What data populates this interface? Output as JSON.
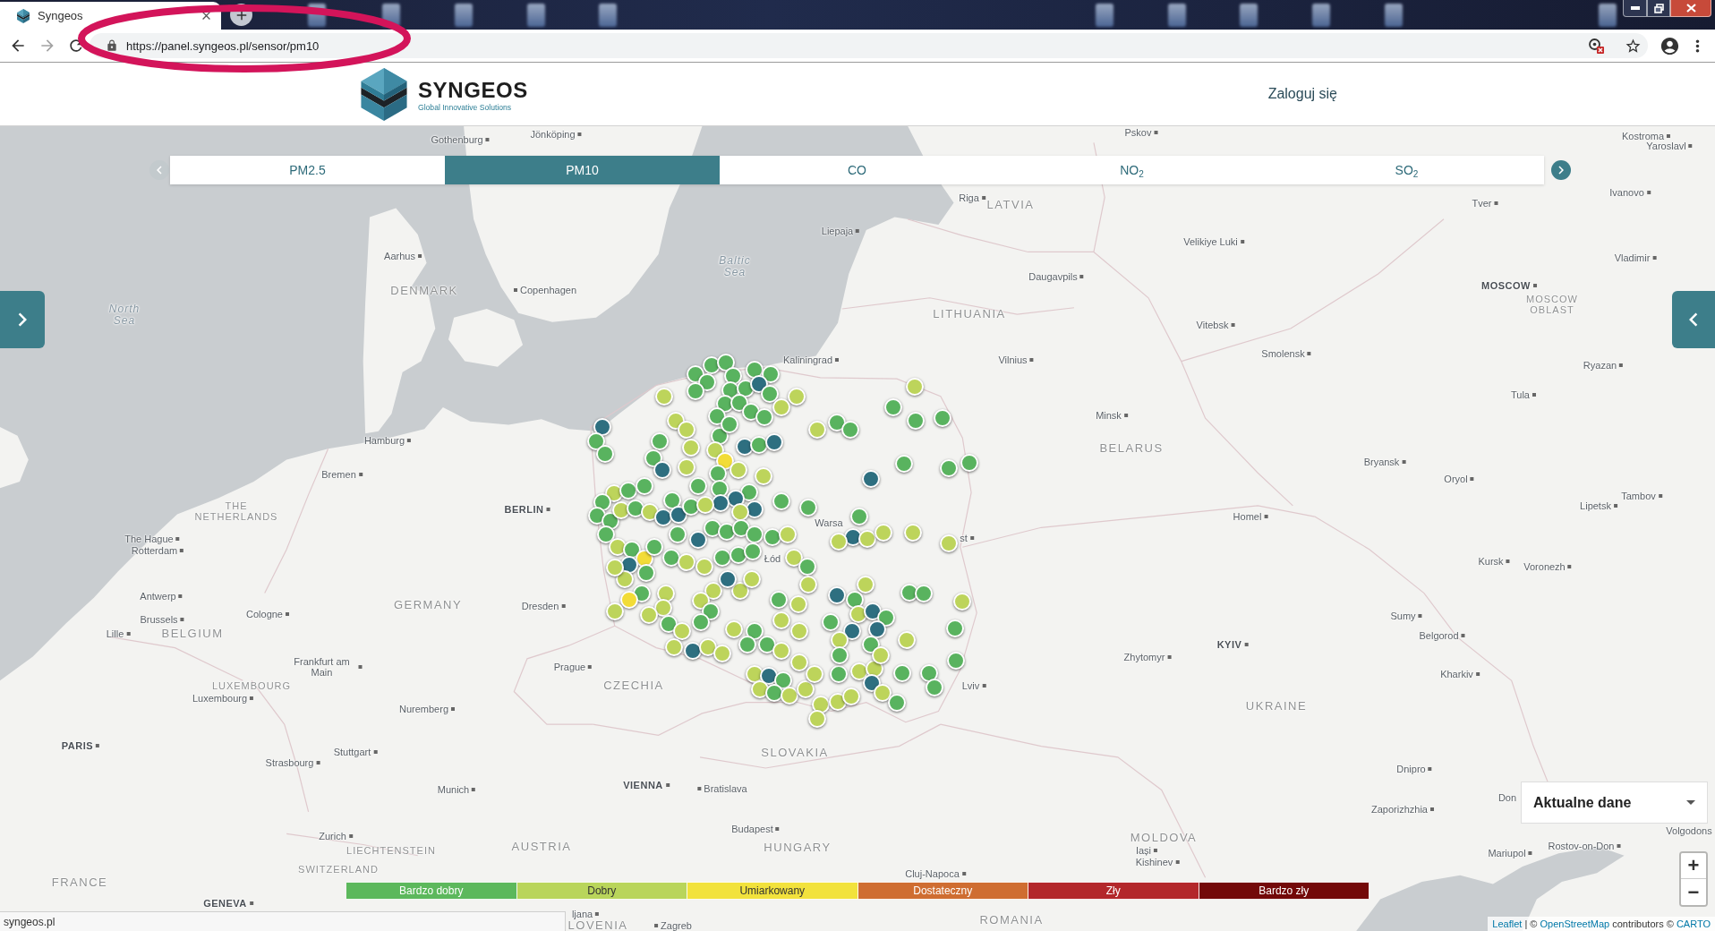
{
  "browser": {
    "tab": {
      "title": "Syngeos"
    },
    "back_button": {
      "disabled": false
    },
    "forward_button": {
      "disabled": true
    },
    "url": "https://panel.syngeos.pl/sensor/pm10",
    "status_text": "syngeos.pl"
  },
  "header": {
    "brand": "SYNGEOS",
    "tagline": "Global Innovative Solutions",
    "login": "Zaloguj się"
  },
  "pollutant_tabs": {
    "prev_button": {
      "disabled": true
    },
    "next_button": {
      "disabled": false
    },
    "tabs": [
      {
        "label": "PM2.5",
        "selected": false
      },
      {
        "label": "PM10",
        "selected": true
      },
      {
        "label": "CO",
        "selected": false
      },
      {
        "label": "NO$_{2}$",
        "selected": false
      },
      {
        "label": "SO$_{2}$",
        "selected": false
      }
    ]
  },
  "map": {
    "labels": [
      {
        "text": "Gothenburg",
        "kind": "city"
      },
      {
        "text": "Jönköping",
        "kind": "city"
      },
      {
        "text": "Pskov",
        "kind": "city"
      },
      {
        "text": "Kostroma",
        "kind": "city"
      },
      {
        "text": "Yaroslavl",
        "kind": "city"
      },
      {
        "text": "Riga",
        "kind": "city"
      },
      {
        "text": "LATVIA",
        "kind": "country"
      },
      {
        "text": "Tver",
        "kind": "city"
      },
      {
        "text": "Ivanovo",
        "kind": "city"
      },
      {
        "text": "Liepaja",
        "kind": "city"
      },
      {
        "text": "Velikiye Luki",
        "kind": "city"
      },
      {
        "text": "Aarhus",
        "kind": "city"
      },
      {
        "text": "Baltic Sea",
        "kind": "sea"
      },
      {
        "text": "Vladimir",
        "kind": "city"
      },
      {
        "text": "Daugavpils",
        "kind": "city"
      },
      {
        "text": "DENMARK",
        "kind": "country"
      },
      {
        "text": "Copenhagen",
        "kind": "city"
      },
      {
        "text": "MOSCOW",
        "kind": "capital"
      },
      {
        "text": "North Sea",
        "kind": "sea"
      },
      {
        "text": "LITHUANIA",
        "kind": "country"
      },
      {
        "text": "MOSCOW OBLAST",
        "kind": "region"
      },
      {
        "text": "Vitebsk",
        "kind": "city"
      },
      {
        "text": "Kaliningrad",
        "kind": "city"
      },
      {
        "text": "Vilnius",
        "kind": "city"
      },
      {
        "text": "Smolensk",
        "kind": "city"
      },
      {
        "text": "Ryazan",
        "kind": "city"
      },
      {
        "text": "Tula",
        "kind": "city"
      },
      {
        "text": "Minsk",
        "kind": "city"
      },
      {
        "text": "Hamburg",
        "kind": "city"
      },
      {
        "text": "BELARUS",
        "kind": "country"
      },
      {
        "text": "Bryansk",
        "kind": "city"
      },
      {
        "text": "Bremen",
        "kind": "city"
      },
      {
        "text": "Oryol",
        "kind": "city"
      },
      {
        "text": "THE NETHERLANDS",
        "kind": "region"
      },
      {
        "text": "BERLIN",
        "kind": "capital"
      },
      {
        "text": "Warsa",
        "kind": "city"
      },
      {
        "text": "Homel",
        "kind": "city"
      },
      {
        "text": "Lipetsk",
        "kind": "city"
      },
      {
        "text": "Tambov",
        "kind": "city"
      },
      {
        "text": "The Hague",
        "kind": "city"
      },
      {
        "text": "st",
        "kind": "city"
      },
      {
        "text": "Rotterdam",
        "kind": "city"
      },
      {
        "text": "Łód",
        "kind": "city"
      },
      {
        "text": "Kursk",
        "kind": "city"
      },
      {
        "text": "Voronezh",
        "kind": "city"
      },
      {
        "text": "Antwerp",
        "kind": "city"
      },
      {
        "text": "Brussels",
        "kind": "city"
      },
      {
        "text": "Cologne",
        "kind": "city"
      },
      {
        "text": "GERMANY",
        "kind": "country"
      },
      {
        "text": "Dresden",
        "kind": "city"
      },
      {
        "text": "Sumy",
        "kind": "city"
      },
      {
        "text": "Lille",
        "kind": "city"
      },
      {
        "text": "BELGIUM",
        "kind": "country"
      },
      {
        "text": "KYIV",
        "kind": "capital"
      },
      {
        "text": "Belgorod",
        "kind": "city"
      },
      {
        "text": "Frankfurt am Main",
        "kind": "city"
      },
      {
        "text": "Prague",
        "kind": "city"
      },
      {
        "text": "Zhytomyr",
        "kind": "city"
      },
      {
        "text": "Kharkiv",
        "kind": "city"
      },
      {
        "text": "LUXEMBOURG",
        "kind": "region"
      },
      {
        "text": "CZECHIA",
        "kind": "country"
      },
      {
        "text": "Lviv",
        "kind": "city"
      },
      {
        "text": "Luxembourg",
        "kind": "city"
      },
      {
        "text": "Nuremberg",
        "kind": "city"
      },
      {
        "text": "UKRAINE",
        "kind": "country"
      },
      {
        "text": "PARIS",
        "kind": "capital"
      },
      {
        "text": "Strasbourg",
        "kind": "city"
      },
      {
        "text": "Stuttgart",
        "kind": "city"
      },
      {
        "text": "SLOVAKIA",
        "kind": "country"
      },
      {
        "text": "Dnipro",
        "kind": "city"
      },
      {
        "text": "Munich",
        "kind": "city"
      },
      {
        "text": "VIENNA",
        "kind": "capital"
      },
      {
        "text": "Bratislava",
        "kind": "city"
      },
      {
        "text": "Don",
        "kind": "city"
      },
      {
        "text": "Zaporizhzhia",
        "kind": "city"
      },
      {
        "text": "Zurich",
        "kind": "city"
      },
      {
        "text": "Budapest",
        "kind": "city"
      },
      {
        "text": "LIECHTENSTEIN",
        "kind": "region"
      },
      {
        "text": "AUSTRIA",
        "kind": "country"
      },
      {
        "text": "HUNGARY",
        "kind": "country"
      },
      {
        "text": "MOLDOVA",
        "kind": "country"
      },
      {
        "text": "Volgodons",
        "kind": "city"
      },
      {
        "text": "Iași",
        "kind": "city"
      },
      {
        "text": "Kishinev",
        "kind": "city"
      },
      {
        "text": "Mariupol",
        "kind": "city"
      },
      {
        "text": "Rostov-on-Don",
        "kind": "city"
      },
      {
        "text": "SWITZERLAND",
        "kind": "region"
      },
      {
        "text": "FRANCE",
        "kind": "country"
      },
      {
        "text": "Cluj-Napoca",
        "kind": "city"
      },
      {
        "text": "GENEVA",
        "kind": "capital"
      },
      {
        "text": "ljana",
        "kind": "city"
      },
      {
        "text": "LOVENIA",
        "kind": "country"
      },
      {
        "text": "Zagreb",
        "kind": "city"
      },
      {
        "text": "ROMANIA",
        "kind": "country"
      }
    ],
    "markers": [
      {
        "color": "#59b35f"
      },
      {
        "color": "#59b35f"
      },
      {
        "color": "#59b35f"
      },
      {
        "color": "#59b35f"
      },
      {
        "color": "#59b35f"
      },
      {
        "color": "#59b35f"
      },
      {
        "color": "#59b35f"
      },
      {
        "color": "#59b35f"
      },
      {
        "color": "#59b35f"
      },
      {
        "color": "#59b35f"
      },
      {
        "color": "#2e6f80"
      },
      {
        "color": "#59b35f"
      },
      {
        "color": "#bdd45b"
      },
      {
        "color": "#bdd45b"
      },
      {
        "color": "#bdd45b"
      },
      {
        "color": "#59b35f"
      },
      {
        "color": "#59b35f"
      },
      {
        "color": "#59b35f"
      },
      {
        "color": "#59b35f"
      },
      {
        "color": "#59b35f"
      },
      {
        "color": "#59b35f"
      },
      {
        "color": "#59b35f"
      },
      {
        "color": "#bdd45b"
      },
      {
        "color": "#bdd45b"
      },
      {
        "color": "#2e6f80"
      },
      {
        "color": "#59b35f"
      },
      {
        "color": "#59b35f"
      },
      {
        "color": "#59b35f"
      },
      {
        "color": "#bdd45b"
      },
      {
        "color": "#59b35f"
      },
      {
        "color": "#2e6f80"
      },
      {
        "color": "#bdd45b"
      },
      {
        "color": "#bdd45b"
      },
      {
        "color": "#f2dc37"
      },
      {
        "color": "#bdd45b"
      },
      {
        "color": "#2e6f80"
      },
      {
        "color": "#59b35f"
      },
      {
        "color": "#2e6f80"
      },
      {
        "color": "#bdd45b"
      },
      {
        "color": "#59b35f"
      },
      {
        "color": "#59b35f"
      },
      {
        "color": "#59b35f"
      },
      {
        "color": "#59b35f"
      },
      {
        "color": "#2e6f80"
      },
      {
        "color": "#2e6f80"
      },
      {
        "color": "#bdd45b"
      },
      {
        "color": "#2e6f80"
      },
      {
        "color": "#59b35f"
      },
      {
        "color": "#59b35f"
      },
      {
        "color": "#bdd45b"
      },
      {
        "color": "#59b35f"
      },
      {
        "color": "#59b35f"
      },
      {
        "color": "#59b35f"
      },
      {
        "color": "#bdd45b"
      },
      {
        "color": "#59b35f"
      },
      {
        "color": "#59b35f"
      },
      {
        "color": "#59b35f"
      },
      {
        "color": "#59b35f"
      },
      {
        "color": "#59b35f"
      },
      {
        "color": "#2e6f80"
      },
      {
        "color": "#59b35f"
      },
      {
        "color": "#2e6f80"
      },
      {
        "color": "#bdd45b"
      },
      {
        "color": "#bdd45b"
      },
      {
        "color": "#bdd45b"
      },
      {
        "color": "#bdd45b"
      },
      {
        "color": "#bdd45b"
      },
      {
        "color": "#bdd45b"
      },
      {
        "color": "#59b35f"
      },
      {
        "color": "#59b35f"
      },
      {
        "color": "#59b35f"
      },
      {
        "color": "#59b35f"
      },
      {
        "color": "#59b35f"
      },
      {
        "color": "#59b35f"
      },
      {
        "color": "#bdd45b"
      },
      {
        "color": "#59b35f"
      },
      {
        "color": "#bdd45b"
      },
      {
        "color": "#2e6f80"
      },
      {
        "color": "#59b35f"
      },
      {
        "color": "#2e6f80"
      },
      {
        "color": "#59b35f"
      },
      {
        "color": "#bdd45b"
      },
      {
        "color": "#59b35f"
      },
      {
        "color": "#2e6f80"
      },
      {
        "color": "#59b35f"
      },
      {
        "color": "#59b35f"
      },
      {
        "color": "#59b35f"
      },
      {
        "color": "#59b35f"
      },
      {
        "color": "#59b35f"
      },
      {
        "color": "#bdd45b"
      },
      {
        "color": "#bdd45b"
      },
      {
        "color": "#59b35f"
      },
      {
        "color": "#f2dc37"
      },
      {
        "color": "#59b35f"
      },
      {
        "color": "#59b35f"
      },
      {
        "color": "#bdd45b"
      },
      {
        "color": "#bdd45b"
      },
      {
        "color": "#59b35f"
      },
      {
        "color": "#59b35f"
      },
      {
        "color": "#59b35f"
      },
      {
        "color": "#2e6f80"
      },
      {
        "color": "#59b35f"
      },
      {
        "color": "#bdd45b"
      },
      {
        "color": "#bdd45b"
      },
      {
        "color": "#bdd45b"
      },
      {
        "color": "#59b35f"
      },
      {
        "color": "#bdd45b"
      },
      {
        "color": "#bdd45b"
      },
      {
        "color": "#bdd45b"
      },
      {
        "color": "#bdd45b"
      },
      {
        "color": "#2e6f80"
      },
      {
        "color": "#59b35f"
      },
      {
        "color": "#f2dc37"
      },
      {
        "color": "#bdd45b"
      },
      {
        "color": "#bdd45b"
      },
      {
        "color": "#bdd45b"
      },
      {
        "color": "#bdd45b"
      },
      {
        "color": "#bdd45b"
      },
      {
        "color": "#59b35f"
      },
      {
        "color": "#59b35f"
      },
      {
        "color": "#bdd45b"
      },
      {
        "color": "#bdd45b"
      },
      {
        "color": "#2e6f80"
      },
      {
        "color": "#bdd45b"
      },
      {
        "color": "#bdd45b"
      },
      {
        "color": "#59b35f"
      },
      {
        "color": "#bdd45b"
      },
      {
        "color": "#59b35f"
      },
      {
        "color": "#bdd45b"
      },
      {
        "color": "#bdd45b"
      },
      {
        "color": "#59b35f"
      },
      {
        "color": "#bdd45b"
      },
      {
        "color": "#59b35f"
      },
      {
        "color": "#59b35f"
      },
      {
        "color": "#bdd45b"
      },
      {
        "color": "#bdd45b"
      },
      {
        "color": "#bdd45b"
      },
      {
        "color": "#2e6f80"
      },
      {
        "color": "#59b35f"
      },
      {
        "color": "#bdd45b"
      },
      {
        "color": "#59b35f"
      },
      {
        "color": "#bdd45b"
      },
      {
        "color": "#bdd45b"
      },
      {
        "color": "#bdd45b"
      },
      {
        "color": "#59b35f"
      },
      {
        "color": "#bdd45b"
      },
      {
        "color": "#bdd45b"
      },
      {
        "color": "#bdd45b"
      },
      {
        "color": "#bdd45b"
      },
      {
        "color": "#bdd45b"
      },
      {
        "color": "#bdd45b"
      },
      {
        "color": "#2e6f80"
      },
      {
        "color": "#bdd45b"
      },
      {
        "color": "#59b35f"
      },
      {
        "color": "#bdd45b"
      },
      {
        "color": "#2e6f80"
      },
      {
        "color": "#59b35f"
      },
      {
        "color": "#2e6f80"
      },
      {
        "color": "#2e6f80"
      },
      {
        "color": "#bdd45b"
      },
      {
        "color": "#59b35f"
      },
      {
        "color": "#59b35f"
      },
      {
        "color": "#59b35f"
      },
      {
        "color": "#bdd45b"
      },
      {
        "color": "#2e6f80"
      },
      {
        "color": "#bdd45b"
      },
      {
        "color": "#59b35f"
      },
      {
        "color": "#59b35f"
      },
      {
        "color": "#59b35f"
      },
      {
        "color": "#59b35f"
      },
      {
        "color": "#bdd45b"
      },
      {
        "color": "#59b35f"
      },
      {
        "color": "#bdd45b"
      },
      {
        "color": "#59b35f"
      },
      {
        "color": "#59b35f"
      },
      {
        "color": "#59b35f"
      }
    ],
    "period_select": {
      "value": "Aktualne dane"
    },
    "zoom": {
      "in": "+",
      "out": "−"
    },
    "attribution": [
      {
        "text": "Leaflet",
        "kind": "link"
      },
      {
        "text": "| ©",
        "kind": "text"
      },
      {
        "text": "OpenStreetMap",
        "kind": "link"
      },
      {
        "text": "contributors ©",
        "kind": "text"
      },
      {
        "text": "CARTO",
        "kind": "link"
      }
    ]
  },
  "legend": [
    {
      "label": "Bardzo dobry",
      "color": "#5cb85c"
    },
    {
      "label": "Dobry",
      "color": "#b9d55b"
    },
    {
      "label": "Umiarkowany",
      "color": "#f2e23c"
    },
    {
      "label": "Dostateczny",
      "color": "#cf6d31"
    },
    {
      "label": "Zły",
      "color": "#b3272b"
    },
    {
      "label": "Bardzo zły",
      "color": "#730909"
    }
  ]
}
